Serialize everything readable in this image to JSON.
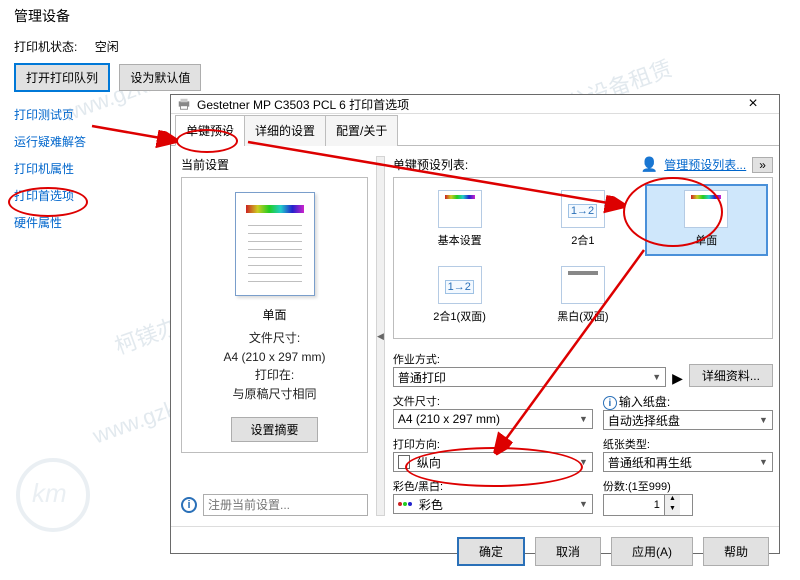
{
  "page": {
    "heading": "管理设备",
    "status_label": "打印机状态:",
    "status_value": "空闲",
    "open_queue_btn": "打开打印队列",
    "set_default_btn": "设为默认值",
    "links": [
      "打印测试页",
      "运行疑难解答",
      "打印机属性",
      "打印首选项",
      "硬件属性"
    ]
  },
  "dialog": {
    "title": "Gestetner MP C3503 PCL 6 打印首选项",
    "tabs": [
      "单键预设",
      "详细的设置",
      "配置/关于"
    ],
    "left": {
      "label": "当前设置",
      "preview_title": "单面",
      "file_size_lbl": "文件尺寸:",
      "file_size_val": "A4 (210 x 297 mm)",
      "print_to_lbl": "打印在:",
      "print_to_val": "与原稿尺寸相同",
      "summary_btn": "设置摘要",
      "register_placeholder": "注册当前设置..."
    },
    "presets": {
      "label": "单键预设列表:",
      "manage": "管理预设列表...",
      "items": [
        {
          "label": "基本设置",
          "type": "color"
        },
        {
          "label": "2合1",
          "type": "2in1"
        },
        {
          "label": "单面",
          "type": "color"
        },
        {
          "label": "2合1(双面)",
          "type": "2in1"
        },
        {
          "label": "黑白(双面)",
          "type": "bw"
        }
      ]
    },
    "form": {
      "job_type_lbl": "作业方式:",
      "job_type_val": "普通打印",
      "detail_btn": "详细资料...",
      "file_size_lbl": "文件尺寸:",
      "file_size_val": "A4 (210 x 297 mm)",
      "tray_lbl": "输入纸盘:",
      "tray_val": "自动选择纸盘",
      "orient_lbl": "打印方向:",
      "orient_val": "纵向",
      "paper_type_lbl": "纸张类型:",
      "paper_type_val": "普通纸和再生纸",
      "color_lbl": "彩色/黑白:",
      "color_val": "彩色",
      "copies_lbl": "份数:(1至999)",
      "copies_val": "1"
    },
    "footer": {
      "ok": "确定",
      "cancel": "取消",
      "apply": "应用(A)",
      "help": "帮助"
    }
  },
  "watermark": "柯镁办公设备租赁"
}
